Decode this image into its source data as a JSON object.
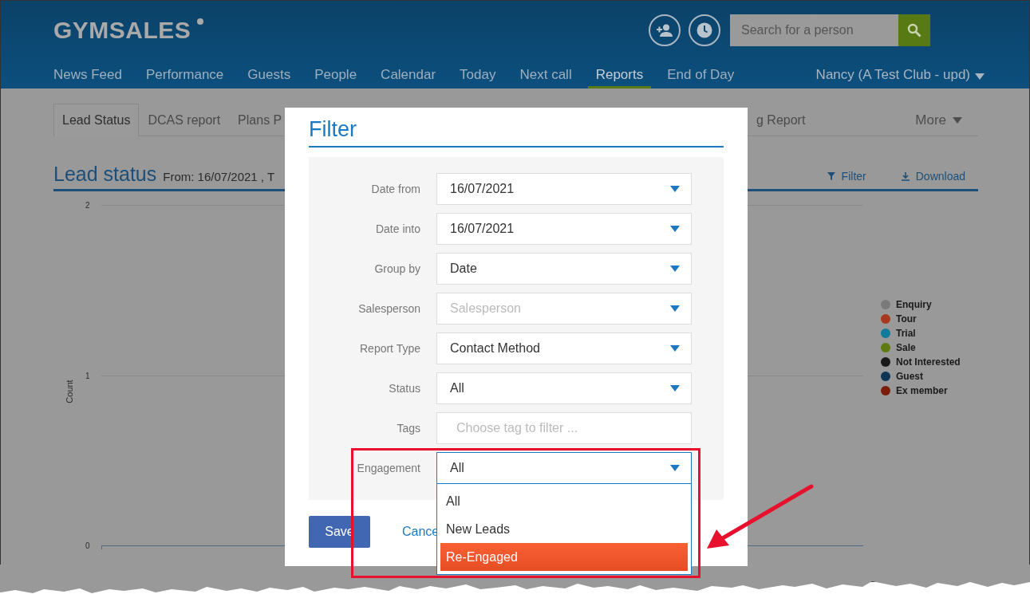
{
  "header": {
    "logo": "GYMSALES",
    "search": {
      "placeholder": "Search for a person"
    },
    "user": "Nancy (A Test Club - upd)"
  },
  "nav": [
    {
      "label": "News Feed",
      "selected": false
    },
    {
      "label": "Performance",
      "selected": false
    },
    {
      "label": "Guests",
      "selected": false
    },
    {
      "label": "People",
      "selected": false
    },
    {
      "label": "Calendar",
      "selected": false
    },
    {
      "label": "Today",
      "selected": false
    },
    {
      "label": "Next call",
      "selected": false
    },
    {
      "label": "Reports",
      "selected": true
    },
    {
      "label": "End of Day",
      "selected": false
    }
  ],
  "tabs": [
    {
      "label": "Lead Status",
      "selected": true
    },
    {
      "label": "DCAS report",
      "selected": false
    },
    {
      "label": "Plans P",
      "selected": false
    }
  ],
  "tabs_right": [
    {
      "label": "g Report",
      "selected": false
    }
  ],
  "more": "More",
  "report": {
    "title": "Lead status",
    "range": "From: 16/07/2021 , T",
    "actions": [
      "Filter",
      "Download"
    ]
  },
  "chart": {
    "ylabel": "Count",
    "yticks": [
      "2",
      "1",
      "0"
    ]
  },
  "legend": [
    {
      "label": "Enquiry",
      "color": "#7a7a7a"
    },
    {
      "label": "Tour",
      "color": "#a8391e"
    },
    {
      "label": "Trial",
      "color": "#0f7a9a"
    },
    {
      "label": "Sale",
      "color": "#5e7a10"
    },
    {
      "label": "Not Interested",
      "color": "#1a1a1a"
    },
    {
      "label": "Guest",
      "color": "#0d3556"
    },
    {
      "label": "Ex member",
      "color": "#7c1c0a"
    }
  ],
  "modal": {
    "title": "Filter",
    "fields": [
      {
        "label": "Date from",
        "kind": "select",
        "value": "16/07/2021"
      },
      {
        "label": "Date into",
        "kind": "select",
        "value": "16/07/2021"
      },
      {
        "label": "Group by",
        "kind": "select",
        "value": "Date"
      },
      {
        "label": "Salesperson",
        "kind": "select",
        "placeholder": "Salesperson"
      },
      {
        "label": "Report Type",
        "kind": "select",
        "value": "Contact Method"
      },
      {
        "label": "Status",
        "kind": "select",
        "value": "All"
      },
      {
        "label": "Tags",
        "kind": "tags",
        "placeholder": "Choose tag to filter ..."
      },
      {
        "label": "Engagement",
        "kind": "select",
        "value": "All",
        "expanded": true,
        "options": [
          {
            "label": "All",
            "highlighted": false
          },
          {
            "label": "New Leads",
            "highlighted": false
          },
          {
            "label": "Re-Engaged",
            "highlighted": true
          }
        ]
      }
    ],
    "save": "Save",
    "cancel": "Cance"
  }
}
